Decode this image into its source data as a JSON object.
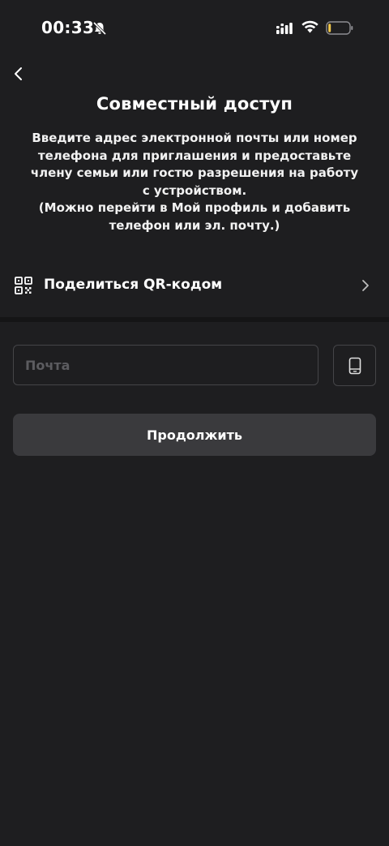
{
  "status_bar": {
    "time": "00:33",
    "icons": [
      "bell-slash-icon",
      "cellular-signal-icon",
      "wifi-icon",
      "battery-low-icon"
    ],
    "battery_color": "#f2c94c"
  },
  "nav": {
    "back_icon": "chevron-left-icon"
  },
  "page": {
    "title": "Совместный доступ",
    "description_lines": [
      "Введите адрес электронной почты или номер",
      "телефона для приглашения и предоставьте",
      "члену семьи или гостю разрешения на работу",
      "с устройством.",
      "(Можно перейти в Мой профиль и добавить",
      "телефон или эл. почту.)"
    ]
  },
  "share_qr": {
    "label": "Поделиться QR-кодом",
    "icon": "qr-code-icon",
    "chevron": "chevron-right-icon"
  },
  "form": {
    "email_placeholder": "Почта",
    "email_value": "",
    "switch_icon": "phone-icon",
    "continue_label": "Продолжить"
  },
  "colors": {
    "background": "#1e1e20",
    "button": "#3a3a3d",
    "border": "#454548",
    "placeholder": "#5c5c60"
  }
}
